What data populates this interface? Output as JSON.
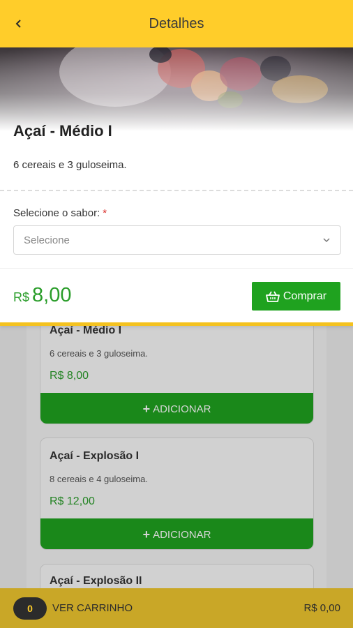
{
  "header": {
    "title": "Detalhes"
  },
  "product": {
    "name": "Açaí - Médio I",
    "description": "6 cereais e 3 guloseima.",
    "flavor_label": "Selecione o sabor:",
    "required_mark": "*",
    "flavor_placeholder": "Selecione",
    "price_currency": "R$",
    "price_amount": "8,00",
    "buy_label": "Comprar"
  },
  "list": {
    "items": [
      {
        "name": "Açaí - Médio I",
        "description": "6 cereais e 3 guloseima.",
        "price": "R$ 8,00",
        "add_label": "ADICIONAR"
      },
      {
        "name": "Açaí - Explosão I",
        "description": "8 cereais e 4 guloseima.",
        "price": "R$ 12,00",
        "add_label": "ADICIONAR"
      },
      {
        "name": "Açaí - Explosão II"
      }
    ]
  },
  "cart": {
    "count": "0",
    "label": "VER CARRINHO",
    "total": "R$ 0,00"
  },
  "colors": {
    "header": "#ffcd2a",
    "green": "#1fa21f",
    "price_green": "#2a9d2a",
    "cart_bar": "#c9a727",
    "required": "#d9302c"
  },
  "icons": {
    "back": "chevron-left-icon",
    "dropdown": "chevron-down-icon",
    "buy": "basket-icon",
    "add": "plus-icon"
  }
}
